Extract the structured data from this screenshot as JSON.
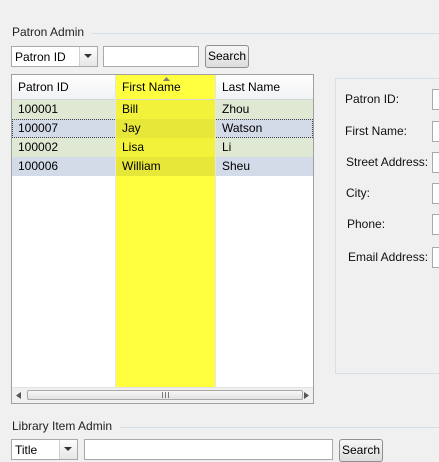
{
  "patron_admin": {
    "title": "Patron Admin",
    "search_by": "Patron ID",
    "search_text": "",
    "search_label": "Search",
    "table": {
      "columns": [
        "Patron ID",
        "First Name",
        "Last Name"
      ],
      "rows": [
        [
          "100001",
          "Bill",
          "Zhou"
        ],
        [
          "100007",
          "Jay",
          "Watson"
        ],
        [
          "100002",
          "Lisa",
          "Li"
        ],
        [
          "100006",
          "William",
          "Sheu"
        ]
      ],
      "highlight_color": "#ffff40",
      "stripe_color": "#dfe8d3",
      "selected_color": "#d4dbe8"
    },
    "details": {
      "patron_id_label": "Patron ID:",
      "first_name_label": "First Name:",
      "street_address_label": "Street Address:",
      "city_label": "City:",
      "phone_label": "Phone:",
      "email_label": "Email Address:"
    }
  },
  "library_item_admin": {
    "title": "Library Item Admin",
    "search_by": "Title",
    "search_text": "",
    "search_label": "Search"
  }
}
